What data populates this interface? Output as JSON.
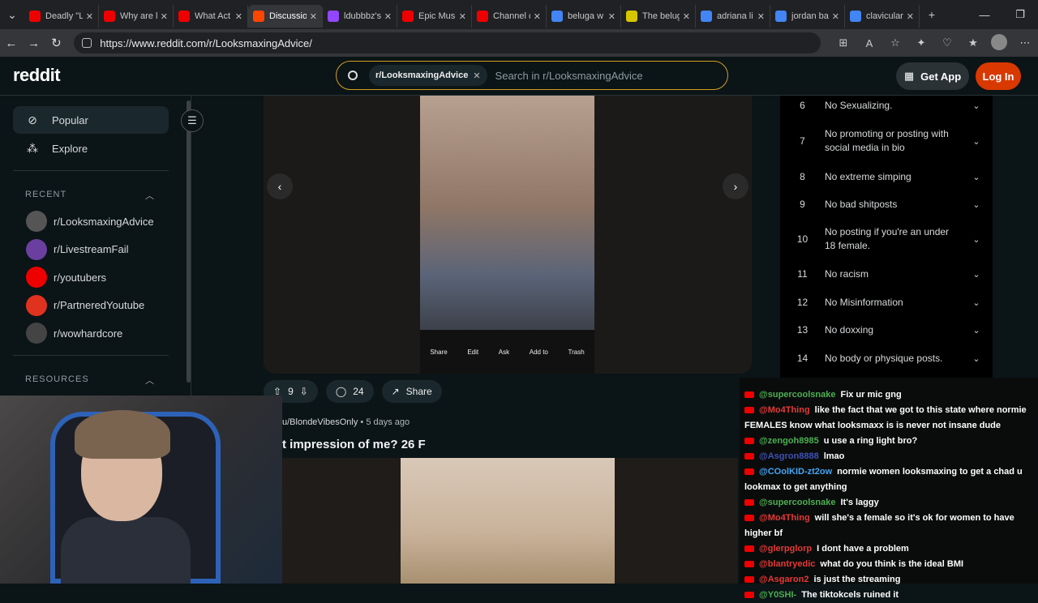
{
  "browser": {
    "tabs": [
      {
        "title": "Deadly \"L",
        "color": "#e00"
      },
      {
        "title": "Why are l",
        "color": "#e00"
      },
      {
        "title": "What Act",
        "color": "#e00"
      },
      {
        "title": "Discussio",
        "color": "#ff4500"
      },
      {
        "title": "ldubbbz's",
        "color": "#9147ff"
      },
      {
        "title": "Epic Musi",
        "color": "#e00"
      },
      {
        "title": "Channel c",
        "color": "#e00"
      },
      {
        "title": "beluga w",
        "color": "#4285f4"
      },
      {
        "title": "The belug",
        "color": "#d6c600"
      },
      {
        "title": "adriana li",
        "color": "#4285f4"
      },
      {
        "title": "jordan ba",
        "color": "#4285f4"
      },
      {
        "title": "clavicular",
        "color": "#4285f4"
      }
    ],
    "new_tab": "+",
    "url": "https://www.reddit.com/r/LooksmaxingAdvice/"
  },
  "header": {
    "logo": "reddit",
    "search_chip": "r/LooksmaxingAdvice",
    "search_placeholder": "Search in r/LooksmaxingAdvice",
    "get_app": "Get App",
    "login": "Log In"
  },
  "sidebar": {
    "items": [
      {
        "label": "Popular",
        "icon": "popular-icon"
      },
      {
        "label": "Explore",
        "icon": "explore-icon"
      }
    ],
    "recent_title": "RECENT",
    "recent": [
      {
        "label": "r/LooksmaxingAdvice",
        "color": "#555"
      },
      {
        "label": "r/LivestreamFail",
        "color": "#6b3fa0"
      },
      {
        "label": "r/youtubers",
        "color": "#e00"
      },
      {
        "label": "r/PartneredYoutube",
        "color": "#e0321f"
      },
      {
        "label": "r/wowhardcore",
        "color": "#444"
      }
    ],
    "resources_title": "RESOURCES"
  },
  "post": {
    "upvotes": "9",
    "comments": "24",
    "share": "Share",
    "photo_bar": [
      "Share",
      "Edit",
      "Ask",
      "Add to",
      "Trash"
    ]
  },
  "next_post": {
    "author": "u/BlondeVibesOnly",
    "age": "5 days ago",
    "title": "t impression of me? 26 F"
  },
  "rules": [
    {
      "n": "6",
      "t": "No Sexualizing."
    },
    {
      "n": "7",
      "t": "No promoting or posting with social media in bio"
    },
    {
      "n": "8",
      "t": "No extreme simping"
    },
    {
      "n": "9",
      "t": "No bad shitposts"
    },
    {
      "n": "10",
      "t": "No posting if you're an under 18 female."
    },
    {
      "n": "11",
      "t": "No racism"
    },
    {
      "n": "12",
      "t": "No Misinformation"
    },
    {
      "n": "13",
      "t": "No doxxing"
    },
    {
      "n": "14",
      "t": "No body or physique posts."
    }
  ],
  "chat": [
    {
      "user": "@supercoolsnake",
      "color": "#4caf50",
      "text": "Fix ur mic gng"
    },
    {
      "user": "@Mo4Thing",
      "color": "#e53935",
      "text": "like the fact that we got to this state where normie FEMALES know what looksmaxx is is never not insane dude"
    },
    {
      "user": "@zengoh8985",
      "color": "#4caf50",
      "text": "u use a ring light bro?"
    },
    {
      "user": "@Asgron8888",
      "color": "#3f51b5",
      "text": "lmao"
    },
    {
      "user": "@COolKID-zt2ow",
      "color": "#42a5f5",
      "text": "normie women looksmaxing to get a chad u lookmax to get anything"
    },
    {
      "user": "@supercoolsnake",
      "color": "#4caf50",
      "text": "It's laggy"
    },
    {
      "user": "@Mo4Thing",
      "color": "#e53935",
      "text": "will she's a female so it's ok for women to have higher bf"
    },
    {
      "user": "@glerpglorp",
      "color": "#e53935",
      "text": "I dont have a problem"
    },
    {
      "user": "@blantryedic",
      "color": "#e53935",
      "text": "what do you think is the ideal BMI"
    },
    {
      "user": "@Asgaron2",
      "color": "#e53935",
      "text": "is just the streaming"
    },
    {
      "user": "@Y0SHI-",
      "color": "#4caf50",
      "text": "The tiktokcels ruined it"
    }
  ]
}
